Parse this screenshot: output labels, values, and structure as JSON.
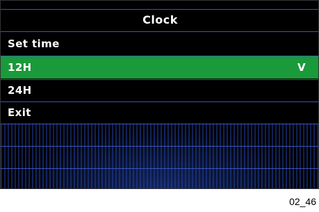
{
  "title": "Clock",
  "menu": {
    "items": [
      {
        "label": "Set time",
        "selected": false,
        "check": ""
      },
      {
        "label": "12H",
        "selected": true,
        "check": "V"
      },
      {
        "label": "24H",
        "selected": false,
        "check": ""
      },
      {
        "label": "Exit",
        "selected": false,
        "check": ""
      }
    ]
  },
  "caption": "02_46",
  "colors": {
    "selected_background": "#1a9a3a",
    "separator": "#3a55b8",
    "text": "#ffffff"
  }
}
